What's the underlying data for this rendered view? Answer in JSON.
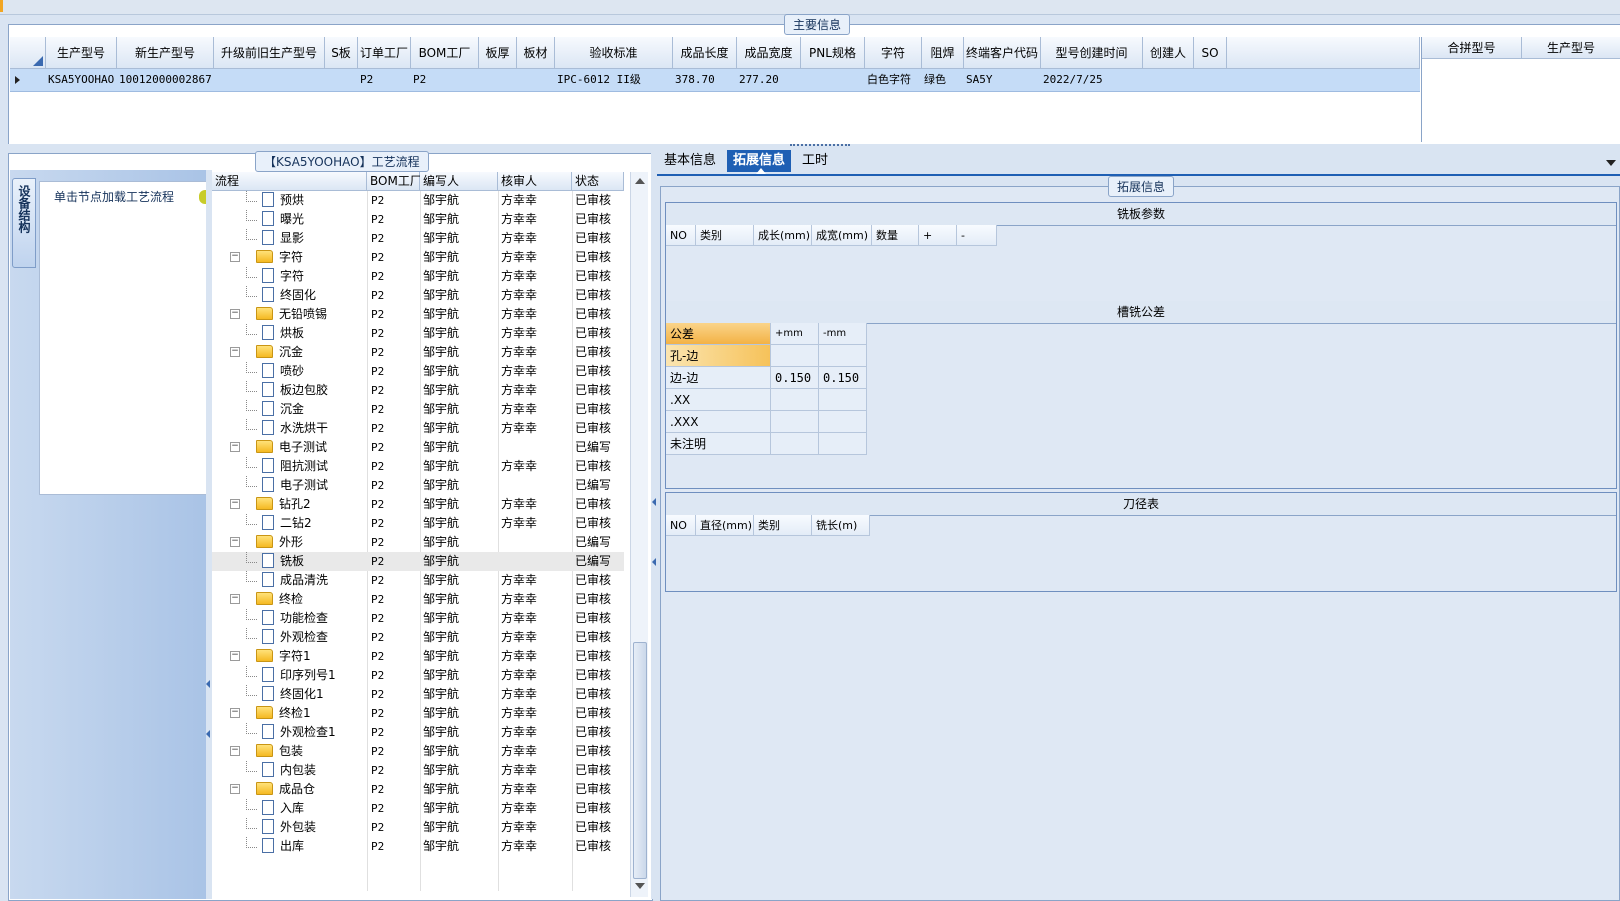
{
  "main_info": {
    "title": "主要信息",
    "columns": [
      "生产型号",
      "新生产型号",
      "升级前旧生产型号",
      "S板",
      "订单工厂",
      "BOM工厂",
      "板厚",
      "板材",
      "验收标准",
      "成品长度",
      "成品宽度",
      "PNL规格",
      "字符",
      "阻焊",
      "终端客户代码",
      "型号创建时间",
      "创建人",
      "SO"
    ],
    "row": [
      "KSA5YOOHAO",
      "10012000002867",
      "",
      "",
      "P2",
      "P2",
      "",
      "",
      "IPC-6012 II级",
      "378.70",
      "277.20",
      "",
      "白色字符",
      "绿色",
      "SA5Y",
      "2022/7/25",
      "",
      ""
    ],
    "side_columns": [
      "合拼型号",
      "生产型号"
    ]
  },
  "flow": {
    "title": "【KSA5YOOHAO】工艺流程",
    "side_tab": "设备结构",
    "hint": "单击节点加载工艺流程",
    "columns": [
      "流程",
      "BOM工厂",
      "编写人",
      "核审人",
      "状态"
    ],
    "rows": [
      {
        "indent": 1,
        "type": "doc",
        "name": "预烘",
        "bom": "P2",
        "writer": "邹宇航",
        "reviewer": "方幸幸",
        "status": "已审核"
      },
      {
        "indent": 1,
        "type": "doc",
        "name": "曝光",
        "bom": "P2",
        "writer": "邹宇航",
        "reviewer": "方幸幸",
        "status": "已审核"
      },
      {
        "indent": 1,
        "type": "doc",
        "name": "显影",
        "bom": "P2",
        "writer": "邹宇航",
        "reviewer": "方幸幸",
        "status": "已审核"
      },
      {
        "indent": 0,
        "type": "folder",
        "name": "字符",
        "bom": "P2",
        "writer": "邹宇航",
        "reviewer": "方幸幸",
        "status": "已审核"
      },
      {
        "indent": 1,
        "type": "doc",
        "name": "字符",
        "bom": "P2",
        "writer": "邹宇航",
        "reviewer": "方幸幸",
        "status": "已审核"
      },
      {
        "indent": 1,
        "type": "doc",
        "name": "终固化",
        "bom": "P2",
        "writer": "邹宇航",
        "reviewer": "方幸幸",
        "status": "已审核"
      },
      {
        "indent": 0,
        "type": "folder",
        "name": "无铅喷锡",
        "bom": "P2",
        "writer": "邹宇航",
        "reviewer": "方幸幸",
        "status": "已审核"
      },
      {
        "indent": 1,
        "type": "doc",
        "name": "烘板",
        "bom": "P2",
        "writer": "邹宇航",
        "reviewer": "方幸幸",
        "status": "已审核"
      },
      {
        "indent": 0,
        "type": "folder",
        "name": "沉金",
        "bom": "P2",
        "writer": "邹宇航",
        "reviewer": "方幸幸",
        "status": "已审核"
      },
      {
        "indent": 1,
        "type": "doc",
        "name": "喷砂",
        "bom": "P2",
        "writer": "邹宇航",
        "reviewer": "方幸幸",
        "status": "已审核"
      },
      {
        "indent": 1,
        "type": "doc",
        "name": "板边包胶",
        "bom": "P2",
        "writer": "邹宇航",
        "reviewer": "方幸幸",
        "status": "已审核"
      },
      {
        "indent": 1,
        "type": "doc",
        "name": "沉金",
        "bom": "P2",
        "writer": "邹宇航",
        "reviewer": "方幸幸",
        "status": "已审核"
      },
      {
        "indent": 1,
        "type": "doc",
        "name": "水洗烘干",
        "bom": "P2",
        "writer": "邹宇航",
        "reviewer": "方幸幸",
        "status": "已审核"
      },
      {
        "indent": 0,
        "type": "folder",
        "name": "电子测试",
        "bom": "P2",
        "writer": "邹宇航",
        "reviewer": "",
        "status": "已编写"
      },
      {
        "indent": 1,
        "type": "doc",
        "name": "阻抗测试",
        "bom": "P2",
        "writer": "邹宇航",
        "reviewer": "方幸幸",
        "status": "已审核"
      },
      {
        "indent": 1,
        "type": "doc",
        "name": "电子测试",
        "bom": "P2",
        "writer": "邹宇航",
        "reviewer": "",
        "status": "已编写"
      },
      {
        "indent": 0,
        "type": "folder",
        "name": "钻孔2",
        "bom": "P2",
        "writer": "邹宇航",
        "reviewer": "方幸幸",
        "status": "已审核"
      },
      {
        "indent": 1,
        "type": "doc",
        "name": "二钻2",
        "bom": "P2",
        "writer": "邹宇航",
        "reviewer": "方幸幸",
        "status": "已审核"
      },
      {
        "indent": 0,
        "type": "folder",
        "name": "外形",
        "bom": "P2",
        "writer": "邹宇航",
        "reviewer": "",
        "status": "已编写"
      },
      {
        "indent": 1,
        "type": "doc",
        "name": "铣板",
        "bom": "P2",
        "writer": "邹宇航",
        "reviewer": "",
        "status": "已编写",
        "selected": true
      },
      {
        "indent": 1,
        "type": "doc",
        "name": "成品清洗",
        "bom": "P2",
        "writer": "邹宇航",
        "reviewer": "方幸幸",
        "status": "已审核"
      },
      {
        "indent": 0,
        "type": "folder",
        "name": "终检",
        "bom": "P2",
        "writer": "邹宇航",
        "reviewer": "方幸幸",
        "status": "已审核"
      },
      {
        "indent": 1,
        "type": "doc",
        "name": "功能检查",
        "bom": "P2",
        "writer": "邹宇航",
        "reviewer": "方幸幸",
        "status": "已审核"
      },
      {
        "indent": 1,
        "type": "doc",
        "name": "外观检查",
        "bom": "P2",
        "writer": "邹宇航",
        "reviewer": "方幸幸",
        "status": "已审核"
      },
      {
        "indent": 0,
        "type": "folder",
        "name": "字符1",
        "bom": "P2",
        "writer": "邹宇航",
        "reviewer": "方幸幸",
        "status": "已审核"
      },
      {
        "indent": 1,
        "type": "doc",
        "name": "印序列号1",
        "bom": "P2",
        "writer": "邹宇航",
        "reviewer": "方幸幸",
        "status": "已审核"
      },
      {
        "indent": 1,
        "type": "doc",
        "name": "终固化1",
        "bom": "P2",
        "writer": "邹宇航",
        "reviewer": "方幸幸",
        "status": "已审核"
      },
      {
        "indent": 0,
        "type": "folder",
        "name": "终检1",
        "bom": "P2",
        "writer": "邹宇航",
        "reviewer": "方幸幸",
        "status": "已审核"
      },
      {
        "indent": 1,
        "type": "doc",
        "name": "外观检查1",
        "bom": "P2",
        "writer": "邹宇航",
        "reviewer": "方幸幸",
        "status": "已审核"
      },
      {
        "indent": 0,
        "type": "folder",
        "name": "包装",
        "bom": "P2",
        "writer": "邹宇航",
        "reviewer": "方幸幸",
        "status": "已审核"
      },
      {
        "indent": 1,
        "type": "doc",
        "name": "内包装",
        "bom": "P2",
        "writer": "邹宇航",
        "reviewer": "方幸幸",
        "status": "已审核"
      },
      {
        "indent": 0,
        "type": "folder",
        "name": "成品仓",
        "bom": "P2",
        "writer": "邹宇航",
        "reviewer": "方幸幸",
        "status": "已审核"
      },
      {
        "indent": 1,
        "type": "doc",
        "name": "入库",
        "bom": "P2",
        "writer": "邹宇航",
        "reviewer": "方幸幸",
        "status": "已审核"
      },
      {
        "indent": 1,
        "type": "doc",
        "name": "外包装",
        "bom": "P2",
        "writer": "邹宇航",
        "reviewer": "方幸幸",
        "status": "已审核"
      },
      {
        "indent": 1,
        "type": "doc",
        "name": "出库",
        "bom": "P2",
        "writer": "邹宇航",
        "reviewer": "方幸幸",
        "status": "已审核"
      }
    ]
  },
  "detail": {
    "tabs": [
      "基本信息",
      "拓展信息",
      "工时"
    ],
    "active_tab": 1,
    "group_title": "拓展信息",
    "mill_params": {
      "title": "铣板参数",
      "columns": [
        "NO",
        "类别",
        "成长(mm)",
        "成宽(mm)",
        "数量",
        "+",
        "-"
      ]
    },
    "mill_tolerance": {
      "title": "槽铣公差",
      "columns": [
        "公差",
        "+mm",
        "-mm"
      ],
      "rows": [
        {
          "label": "孔-边",
          "plus": "",
          "minus": ""
        },
        {
          "label": "边-边",
          "plus": "0.150",
          "minus": "0.150"
        },
        {
          "label": ".XX",
          "plus": "",
          "minus": ""
        },
        {
          "label": ".XXX",
          "plus": "",
          "minus": ""
        },
        {
          "label": "未注明",
          "plus": "",
          "minus": ""
        }
      ]
    },
    "tool_table": {
      "title": "刀径表",
      "columns": [
        "NO",
        "直径(mm)",
        "类别",
        "铣长(m)"
      ]
    }
  },
  "colors": {
    "accent": "#1e5fb4",
    "selected_row": "#c5dcf7",
    "highlight": "#f8c25c"
  }
}
